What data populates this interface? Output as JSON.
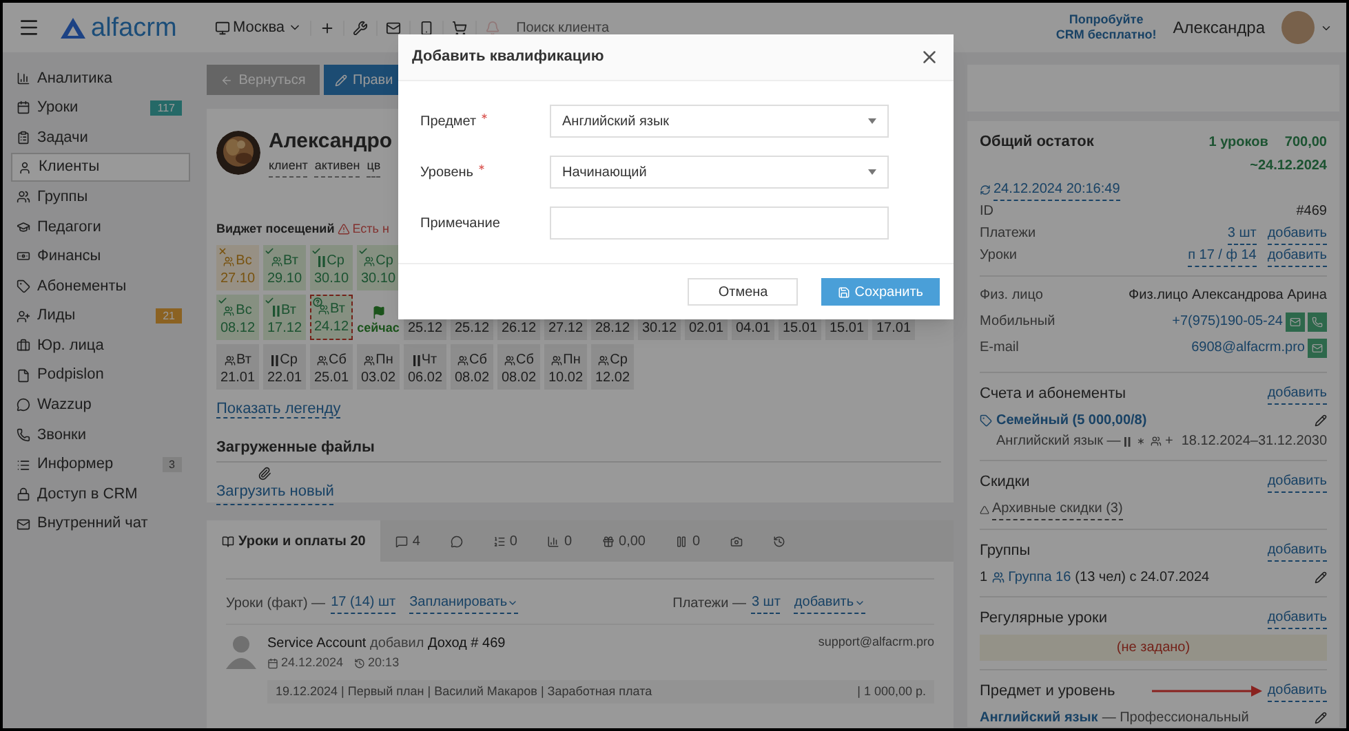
{
  "header": {
    "logo": "alfacrm",
    "branch": "Москва",
    "search": {
      "placeholder": "Поиск клиента"
    },
    "promo": [
      "Попробуйте",
      "CRM бесплатно!"
    ],
    "user": "Александра"
  },
  "sidebar": {
    "items": [
      {
        "label": "Аналитика",
        "selected": false
      },
      {
        "label": "Уроки",
        "selected": false,
        "badge": "117",
        "kind": "info"
      },
      {
        "label": "Задачи",
        "selected": false
      },
      {
        "label": "Клиенты",
        "selected": true
      },
      {
        "label": "Группы",
        "selected": false
      },
      {
        "label": "Педагоги",
        "selected": false
      },
      {
        "label": "Финансы",
        "selected": false
      },
      {
        "label": "Абонементы",
        "selected": false
      },
      {
        "label": "Лиды",
        "selected": false,
        "badge": "21",
        "kind": "warning"
      },
      {
        "label": "Юр. лица",
        "selected": false
      },
      {
        "label": "Podpislon",
        "selected": false
      },
      {
        "label": "Wazzup",
        "selected": false
      },
      {
        "label": "Звонки",
        "selected": false
      },
      {
        "label": "Информер",
        "selected": false,
        "badge": "3",
        "kind": "muted"
      },
      {
        "label": "Доступ в CRM",
        "selected": false
      },
      {
        "label": "Внутренний чат",
        "selected": false
      }
    ]
  },
  "toolbar": {
    "back": "Вернуться",
    "edit": "Прави"
  },
  "client": {
    "name": "Александро",
    "tags": [
      "клиент",
      "активен",
      "цв"
    ]
  },
  "attendance": {
    "title": "Виджет посещений",
    "warning": "Есть н",
    "legend_link": "Показать легенду",
    "rows": [
      [
        {
          "group": true,
          "day": "Вс",
          "date": "27.10",
          "kind": "missed"
        },
        {
          "group": true,
          "day": "Вт",
          "date": "29.10",
          "kind": "attended"
        },
        {
          "group": false,
          "day": "Ср",
          "date": "30.10",
          "kind": "attended"
        },
        {
          "group": true,
          "day": "Ср",
          "date": "30.10",
          "kind": "attended"
        }
      ],
      [
        {
          "group": true,
          "day": "Вс",
          "date": "08.12",
          "kind": "attended"
        },
        {
          "group": false,
          "day": "Вт",
          "date": "17.12",
          "kind": "attended"
        },
        {
          "group": true,
          "day": "Вт",
          "date": "24.12",
          "kind": "unknown"
        },
        {
          "kind": "now",
          "label": "сейчас"
        },
        {
          "kind": "planned",
          "date": "25.12"
        },
        {
          "kind": "planned",
          "date": "25.12"
        },
        {
          "kind": "planned",
          "date": "26.12"
        },
        {
          "kind": "planned",
          "date": "27.12"
        },
        {
          "kind": "planned",
          "date": "28.12"
        },
        {
          "kind": "planned",
          "date": "30.12"
        },
        {
          "kind": "planned",
          "date": "02.01"
        },
        {
          "kind": "planned",
          "date": "04.01"
        },
        {
          "kind": "planned",
          "date": "15.01"
        },
        {
          "kind": "planned",
          "date": "15.01"
        },
        {
          "kind": "planned",
          "date": "17.01"
        }
      ],
      [
        {
          "group": true,
          "day": "Вт",
          "date": "21.01",
          "kind": "planned"
        },
        {
          "group": false,
          "day": "Ср",
          "date": "22.01",
          "kind": "planned"
        },
        {
          "group": true,
          "day": "Сб",
          "date": "25.01",
          "kind": "planned"
        },
        {
          "group": true,
          "day": "Пн",
          "date": "03.02",
          "kind": "planned"
        },
        {
          "group": false,
          "day": "Чт",
          "date": "06.02",
          "kind": "planned"
        },
        {
          "group": true,
          "day": "Сб",
          "date": "08.02",
          "kind": "planned"
        },
        {
          "group": true,
          "day": "Сб",
          "date": "08.02",
          "kind": "planned"
        },
        {
          "group": true,
          "day": "Пн",
          "date": "10.02",
          "kind": "planned"
        },
        {
          "group": true,
          "day": "Ср",
          "date": "12.02",
          "kind": "planned"
        }
      ]
    ]
  },
  "files": {
    "title": "Загруженные файлы",
    "upload": "Загрузить новый"
  },
  "tabs": [
    {
      "label": "Уроки и оплаты 20",
      "selected": true
    },
    {
      "label": "4",
      "selected": false
    },
    {
      "selected": false
    },
    {
      "label": "0",
      "selected": false
    },
    {
      "label": "0",
      "selected": false
    },
    {
      "label": "0,00",
      "selected": false
    },
    {
      "label": "0",
      "selected": false
    },
    {
      "selected": false
    },
    {
      "selected": false
    }
  ],
  "lessons": {
    "label": "Уроки (факт) —",
    "count": "17 (14) шт",
    "plan": "Запланировать",
    "payments_label": "Платежи —",
    "payments_count": "3 шт",
    "add": "добавить"
  },
  "feed": [
    {
      "author": "Service Account",
      "action": "добавил",
      "object": "Доход # 469",
      "date": "24.12.2024",
      "time": "20:13",
      "email": "support@alfacrm.pro",
      "details": "19.12.2024 | Первый план | Василий Макаров | Заработная плата",
      "amount": "| 1 000,00 р."
    }
  ],
  "balance": {
    "title": "Общий остаток",
    "lessons": "1 уроков",
    "amount": "700,00",
    "until": "~24.12.2024",
    "updated": "24.12.2024 20:16:49"
  },
  "info": [
    {
      "label": "ID",
      "value": "#469"
    },
    {
      "label": "Платежи",
      "value": "3 шт",
      "action": "добавить"
    },
    {
      "label": "Уроки",
      "value": "п 17 / ф 14",
      "action": "добавить"
    }
  ],
  "contacts": [
    {
      "label": "Физ. лицо",
      "value": "Физ.лицо Александрова Арина",
      "kind": "text"
    },
    {
      "label": "Мобильный",
      "value": "+7(975)190-05-24",
      "kind": "phone"
    },
    {
      "label": "E-mail",
      "value": "6908@alfacrm.pro",
      "kind": "email"
    }
  ],
  "subscriptions": {
    "title": "Счета и абонементы",
    "add": "добавить",
    "name": "Семейный (5 000,00/8)",
    "subject": "Английский язык —",
    "plus": "+",
    "period": "18.12.2024–31.12.2030"
  },
  "discounts": {
    "title": "Скидки",
    "add": "добавить",
    "archive": "Архивные скидки (3)"
  },
  "groups": {
    "title": "Группы",
    "add": "добавить",
    "count": "1",
    "name": "Группа 16",
    "info": "(13 чел) с 24.07.2024"
  },
  "regular": {
    "title": "Регулярные уроки",
    "add": "добавить",
    "empty": "(не задано)"
  },
  "skills": {
    "title": "Предмет и уровень",
    "add": "добавить",
    "subject": "Английский язык",
    "level": "— Профессиональный"
  },
  "modal": {
    "title": "Добавить квалификацию",
    "fields": [
      {
        "label": "Предмет",
        "required": true,
        "kind": "select",
        "value": "Английский язык"
      },
      {
        "label": "Уровень",
        "required": true,
        "kind": "select",
        "value": "Начинающий"
      },
      {
        "label": "Примечание",
        "required": false,
        "kind": "textarea"
      }
    ],
    "buttons": [
      {
        "label": "Отмена",
        "kind": "secondary"
      },
      {
        "label": "Сохранить",
        "kind": "primary"
      }
    ]
  }
}
